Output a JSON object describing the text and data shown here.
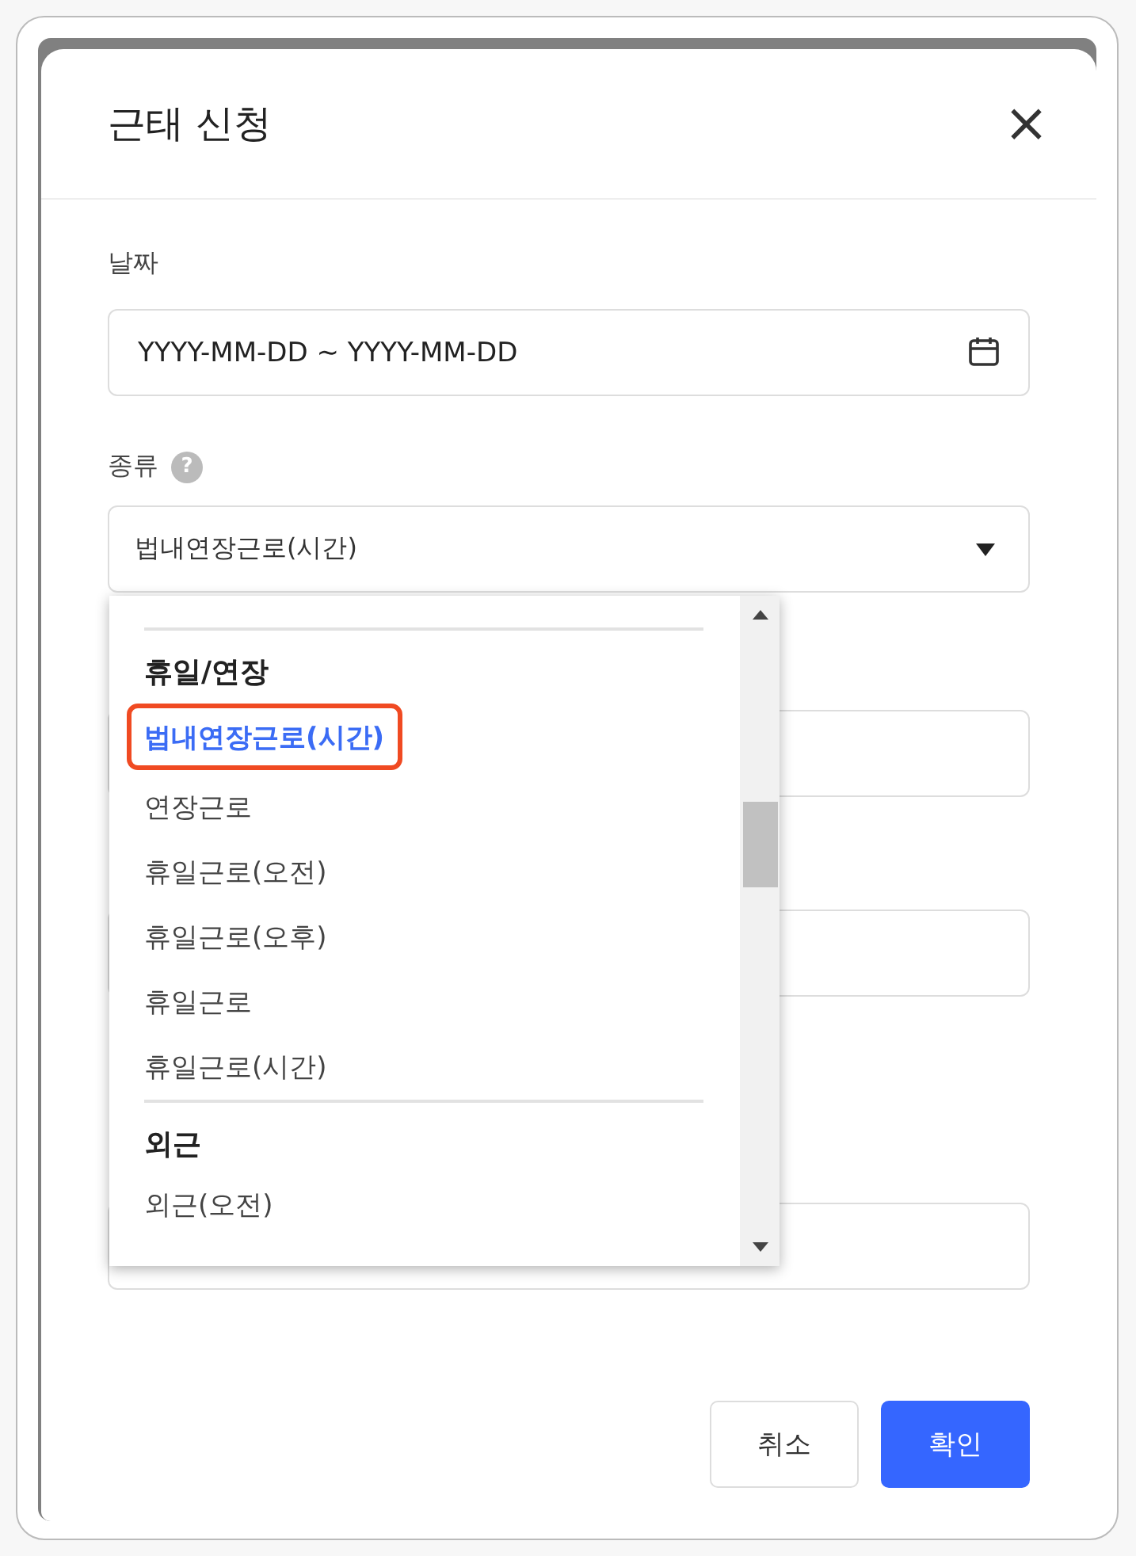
{
  "dialog": {
    "title": "근태 신청",
    "close": "×"
  },
  "date": {
    "label": "날짜",
    "placeholder": "YYYY-MM-DD ~ YYYY-MM-DD"
  },
  "type": {
    "label": "종류",
    "help": "?",
    "value": "법내연장근로(시간)",
    "expanded": true
  },
  "dropdown": {
    "groups": [
      {
        "header": "휴일/연장",
        "items": [
          {
            "label": "법내연장근로(시간)",
            "selected": true
          },
          {
            "label": "연장근로",
            "selected": false
          },
          {
            "label": "휴일근로(오전)",
            "selected": false
          },
          {
            "label": "휴일근로(오후)",
            "selected": false
          },
          {
            "label": "휴일근로",
            "selected": false
          },
          {
            "label": "휴일근로(시간)",
            "selected": false
          }
        ]
      },
      {
        "header": "외근",
        "items": [
          {
            "label": "외근(오전)",
            "selected": false
          }
        ]
      }
    ]
  },
  "covered_fields": [
    {
      "kind": "input"
    },
    {
      "kind": "input"
    },
    {
      "kind": "input"
    }
  ],
  "buttons": [
    {
      "label": "취소",
      "kind": "secondary"
    },
    {
      "label": "확인",
      "kind": "primary"
    }
  ]
}
